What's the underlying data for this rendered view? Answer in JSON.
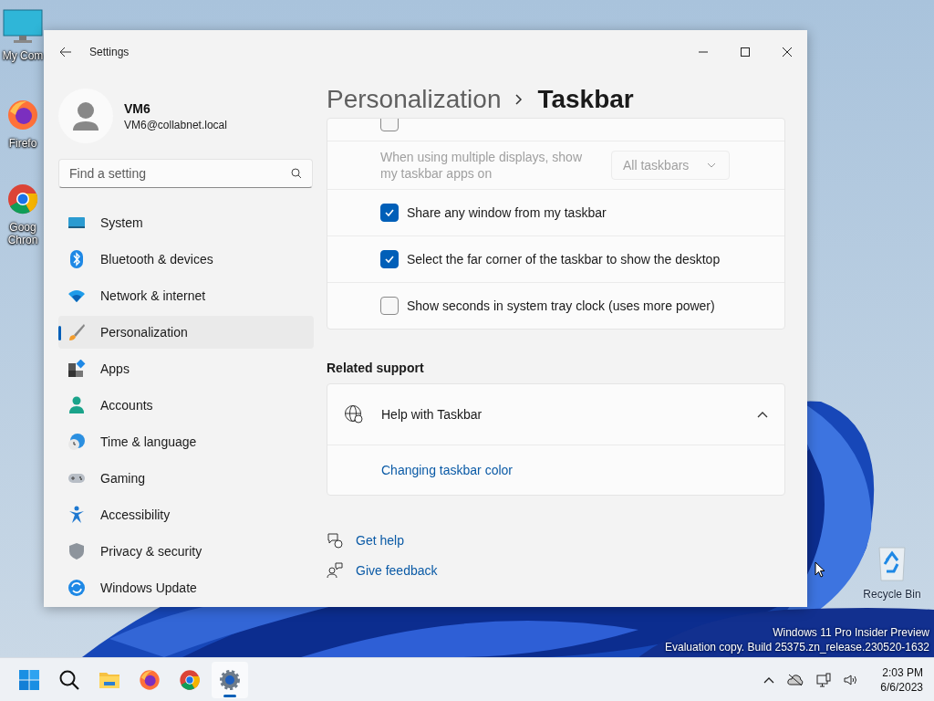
{
  "desktop": {
    "icons": [
      {
        "kind": "computer",
        "label": "My Com"
      },
      {
        "kind": "firefox",
        "label": "Firefo"
      },
      {
        "kind": "chrome",
        "label": "Goog Chron"
      },
      {
        "kind": "recycle",
        "label": "Recycle Bin"
      }
    ],
    "watermark_lines": [
      "Windows 11 Pro Insider Preview",
      "Evaluation copy. Build 25375.zn_release.230520-1632"
    ]
  },
  "window": {
    "title": "Settings",
    "user": {
      "name": "VM6",
      "email": "VM6@collabnet.local"
    },
    "search": {
      "placeholder": "Find a setting"
    },
    "nav": [
      {
        "kind": "system",
        "label": "System",
        "selected": false
      },
      {
        "kind": "bluetooth",
        "label": "Bluetooth & devices",
        "selected": false
      },
      {
        "kind": "network",
        "label": "Network & internet",
        "selected": false
      },
      {
        "kind": "personalization",
        "label": "Personalization",
        "selected": true
      },
      {
        "kind": "apps",
        "label": "Apps",
        "selected": false
      },
      {
        "kind": "accounts",
        "label": "Accounts",
        "selected": false
      },
      {
        "kind": "time",
        "label": "Time & language",
        "selected": false
      },
      {
        "kind": "gaming",
        "label": "Gaming",
        "selected": false
      },
      {
        "kind": "accessibility",
        "label": "Accessibility",
        "selected": false
      },
      {
        "kind": "privacy",
        "label": "Privacy & security",
        "selected": false
      },
      {
        "kind": "update",
        "label": "Windows Update",
        "selected": false
      }
    ],
    "breadcrumb": [
      "Personalization",
      "Taskbar"
    ],
    "rows": [
      {
        "kind": "partial",
        "checked": false
      },
      {
        "kind": "dropdown",
        "label": "When using multiple displays, show my taskbar apps on",
        "value": "All taskbars",
        "disabled": true
      },
      {
        "kind": "checkbox",
        "label": "Share any window from my taskbar",
        "checked": true
      },
      {
        "kind": "checkbox",
        "label": "Select the far corner of the taskbar to show the desktop",
        "checked": true
      },
      {
        "kind": "checkbox",
        "label": "Show seconds in system tray clock (uses more power)",
        "checked": false
      }
    ],
    "related": {
      "heading": "Related support",
      "title": "Help with Taskbar",
      "expanded": true,
      "links": [
        "Changing taskbar color"
      ]
    },
    "footer_links": [
      {
        "kind": "help",
        "label": "Get help"
      },
      {
        "kind": "feedback",
        "label": "Give feedback"
      }
    ]
  },
  "taskbar": {
    "apps": [
      {
        "kind": "start",
        "selected": false
      },
      {
        "kind": "search",
        "selected": false
      },
      {
        "kind": "explorer",
        "selected": false
      },
      {
        "kind": "firefox",
        "selected": false
      },
      {
        "kind": "chrome",
        "selected": false
      },
      {
        "kind": "settings",
        "selected": true
      }
    ],
    "time": "2:03 PM",
    "date": "6/6/2023"
  }
}
